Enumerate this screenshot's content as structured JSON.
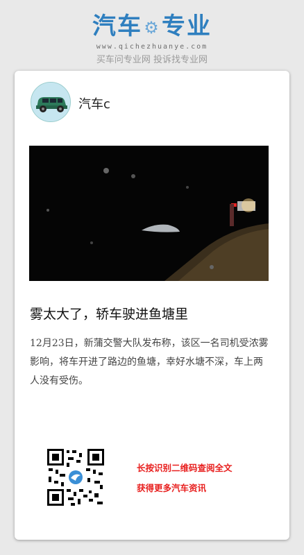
{
  "brand": {
    "title_left": "汽车",
    "title_right": "专业",
    "url": "www.qichezhuanye.com",
    "slogan": "买车问专业网 投诉找专业网"
  },
  "author": {
    "name": "汽车c"
  },
  "article": {
    "headline": "雾太大了，轿车驶进鱼塘里",
    "body": "12月23日，新蒲交警大队发布称，该区一名司机受浓雾影响，将车开进了路边的鱼塘，幸好水塘不深，车上两人没有受伤。"
  },
  "cta": {
    "line1": "长按识别二维码查阅全文",
    "line2": "获得更多汽车资讯"
  },
  "colors": {
    "brand_blue": "#2f7fbf",
    "cta_red": "#e8201f"
  },
  "icons": {
    "brand_gear": "gear-icon",
    "qr_center": "bird-logo-icon"
  }
}
